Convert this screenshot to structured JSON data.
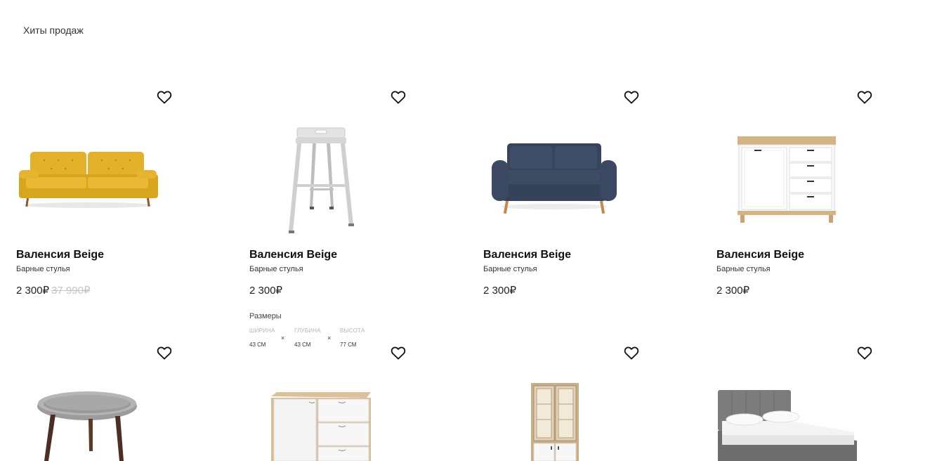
{
  "section_title": "Хиты продаж",
  "products": [
    {
      "name": "Валенсия Beige",
      "category": "Барные стулья",
      "price": "2 300₽",
      "old_price": "37 990₽",
      "image": "yellow-sofa"
    },
    {
      "name": "Валенсия Beige",
      "category": "Барные стулья",
      "price": "2 300₽",
      "old_price": "",
      "image": "white-bar-stool"
    },
    {
      "name": "Валенсия Beige",
      "category": "Барные стулья",
      "price": "2 300₽",
      "old_price": "",
      "image": "navy-loveseat"
    },
    {
      "name": "Валенсия Beige",
      "category": "Барные стулья",
      "price": "2 300₽",
      "old_price": "",
      "image": "white-chest-of-drawers"
    }
  ],
  "sizes": {
    "title": "Размеры",
    "width_label": "ШИРИНА",
    "width_value": "43 СМ",
    "depth_label": "ГЛУБИНА",
    "depth_value": "43 СМ",
    "height_label": "ВЫСОТА",
    "height_value": "77 СМ",
    "separator": "×"
  },
  "second_row_images": [
    "grey-round-table",
    "oak-white-dresser",
    "glass-cabinet",
    "grey-bed"
  ],
  "icons": {
    "favorite": "heart-icon"
  }
}
